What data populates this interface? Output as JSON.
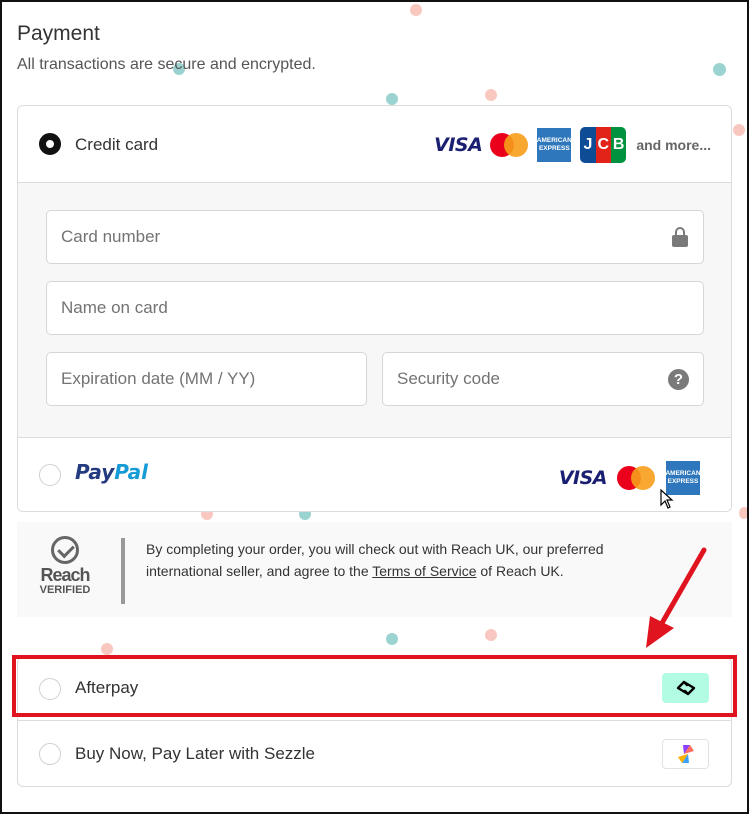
{
  "payment": {
    "title": "Payment",
    "subtitle": "All transactions are secure and encrypted."
  },
  "credit_card": {
    "label": "Credit card",
    "selected": true,
    "card_brand_icons": [
      "visa-logo",
      "mastercard-logo",
      "amex-logo",
      "jcb-logo"
    ],
    "visa_text": "VISA",
    "amex_text": "AMERICAN EXPRESS",
    "jcb_text": [
      "J",
      "C",
      "B"
    ],
    "and_more": "and more...",
    "fields": {
      "card_number": {
        "placeholder": "Card number",
        "icon": "lock-icon"
      },
      "name_on_card": {
        "placeholder": "Name on card"
      },
      "expiration": {
        "placeholder": "Expiration date (MM / YY)"
      },
      "security_code": {
        "placeholder": "Security code",
        "icon": "help-icon",
        "icon_text": "?"
      }
    }
  },
  "paypal": {
    "logo_pay": "Pay",
    "logo_pal": "Pal",
    "selected": false,
    "card_brand_icons": [
      "visa-logo",
      "mastercard-logo",
      "amex-logo"
    ],
    "visa_text": "VISA",
    "amex_text": "AMERICAN EXPRESS"
  },
  "reach": {
    "logo_name": "Reach",
    "logo_verified": "VERIFIED",
    "text_before_link": "By completing your order, you will check out with Reach UK, our preferred international seller, and agree to the ",
    "link_text": "Terms of Service",
    "text_after_link": " of Reach UK."
  },
  "afterpay": {
    "label": "Afterpay",
    "selected": false,
    "icon": "afterpay-icon",
    "highlighted": true
  },
  "sezzle": {
    "label": "Buy Now, Pay Later with Sezzle",
    "selected": false,
    "icon": "sezzle-icon"
  },
  "colors": {
    "highlight": "#e0141e",
    "afterpay_mint": "#b2fce4",
    "visa_blue": "#1a1f71",
    "paypal_dark": "#253b80",
    "paypal_light": "#179bd7",
    "amex_blue": "#2e77bc"
  }
}
